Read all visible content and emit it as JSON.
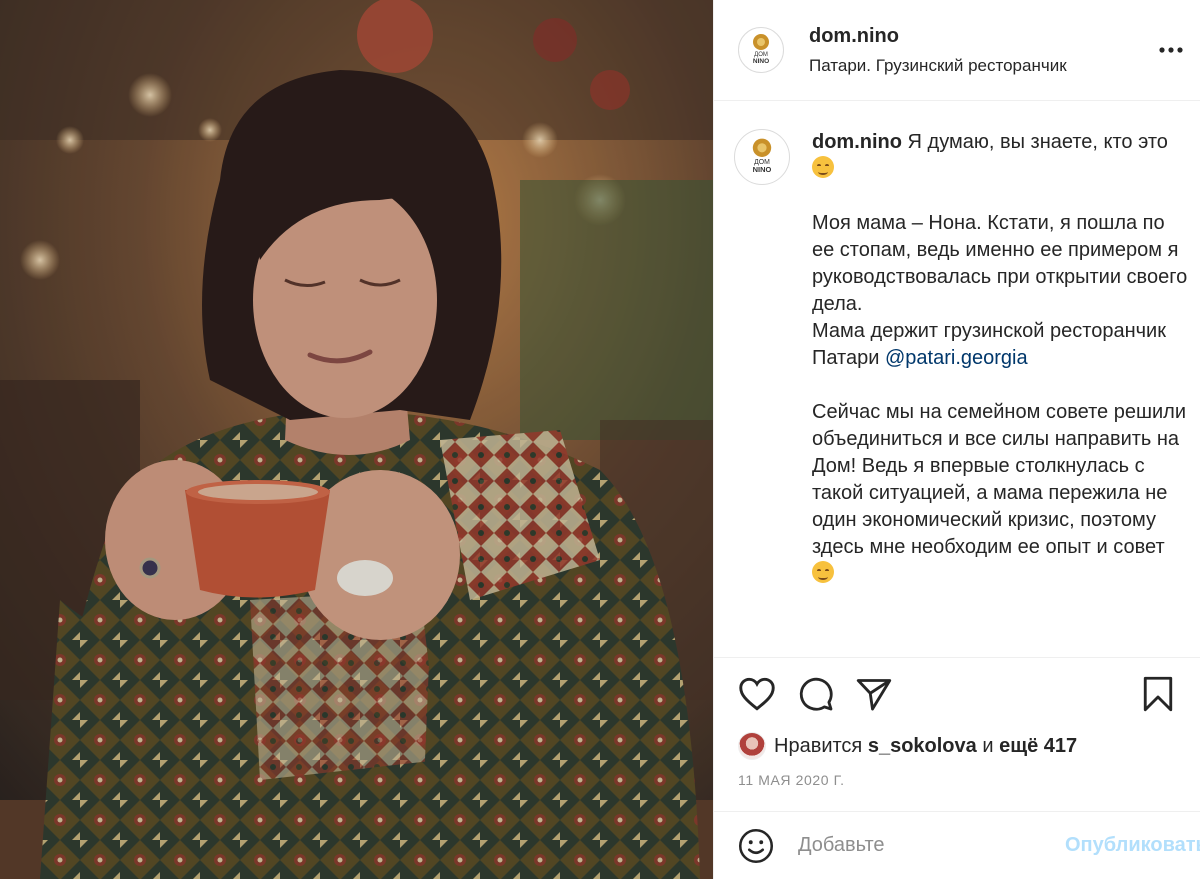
{
  "header": {
    "username": "dom.nino",
    "location": "Патари. Грузинский ресторанчик",
    "more_icon": "more-horizontal-icon"
  },
  "logo": {
    "line1": "ДОМ",
    "line2": "NINO"
  },
  "caption": {
    "username": "dom.nino",
    "first_line": "Я думаю, вы знаете, кто это",
    "paragraph2_a": "Моя мама – Нона. Кстати, я пошла по ее стопам, ведь именно ее примером я руководствовалась при открытии своего дела.",
    "paragraph2_b": "Мама держит грузинской ресторанчик Патари",
    "mention": "@patari.georgia",
    "paragraph3": "Сейчас мы на семейном совете решили объединиться и все силы направить на Дом! Ведь я впервые столкнулась с такой ситуацией, а мама пережила не один экономический кризис, поэтому здесь мне необходим ее опыт и совет"
  },
  "actions": {
    "like_icon": "heart-icon",
    "comment_icon": "comment-icon",
    "share_icon": "paper-plane-icon",
    "save_icon": "bookmark-icon"
  },
  "likes": {
    "prefix": "Нравится",
    "user": "s_sokolova",
    "and": "и",
    "more": "ещё 417"
  },
  "date": "11 МАЯ 2020 Г.",
  "comment_box": {
    "emoji_icon": "smiley-icon",
    "placeholder": "Добавьте",
    "publish_label": "Опубликовать"
  },
  "colors": {
    "link": "#00376b",
    "publish_disabled": "#b2dffc",
    "muted": "#8e8e8e",
    "logo_gold": "#c9912a"
  }
}
